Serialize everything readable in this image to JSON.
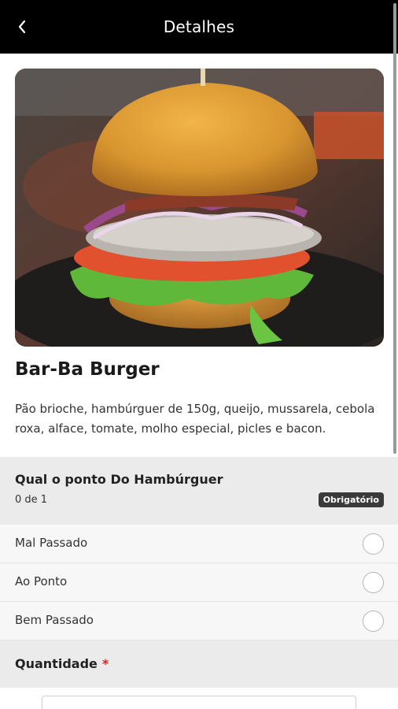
{
  "header": {
    "title": "Detalhes",
    "back_icon": "chevron-left-icon"
  },
  "product": {
    "name": "Bar-Ba Burger",
    "description": "Pão brioche, hambúrguer de 150g, queijo, mussarela, cebola roxa, alface, tomate, molho especial, picles e bacon."
  },
  "option_group": {
    "title": "Qual o ponto Do Hambúrguer",
    "count": "0 de 1",
    "badge": "Obrigatório",
    "options": [
      {
        "label": "Mal Passado",
        "selected": false
      },
      {
        "label": "Ao Ponto",
        "selected": false
      },
      {
        "label": "Bem Passado",
        "selected": false
      }
    ]
  },
  "quantity": {
    "title": "Quantidade",
    "required_marker": "*"
  },
  "colors": {
    "header_bg": "#000000",
    "section_bg": "#ebebeb",
    "badge_bg": "#3a3a3a",
    "required": "#e02020",
    "plus": "#2e9e3e"
  }
}
